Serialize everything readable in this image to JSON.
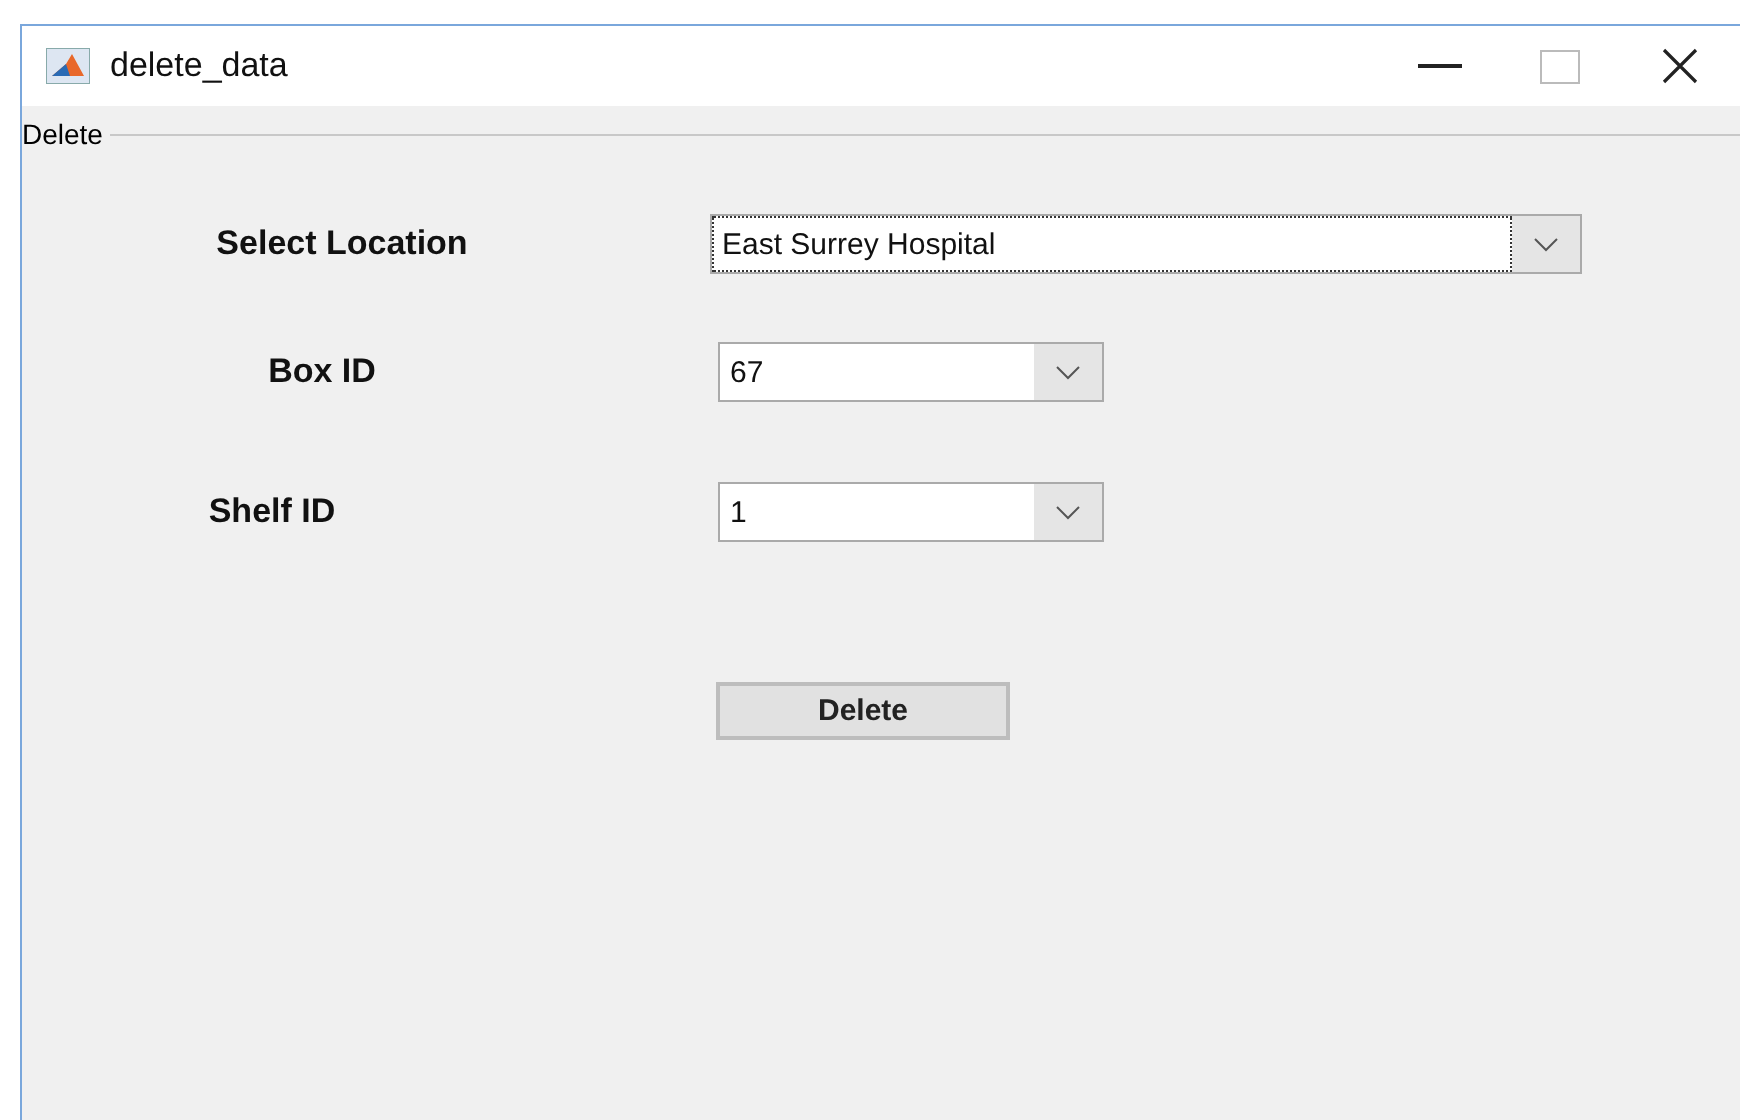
{
  "window": {
    "title": "delete_data"
  },
  "panel": {
    "title": "Delete"
  },
  "fields": [
    {
      "label": "Select Location",
      "value": "East Surrey Hospital",
      "focused": true
    },
    {
      "label": "Box ID",
      "value": "67",
      "focused": false
    },
    {
      "label": "Shelf ID",
      "value": "1",
      "focused": false
    }
  ],
  "buttons": [
    "Delete"
  ]
}
